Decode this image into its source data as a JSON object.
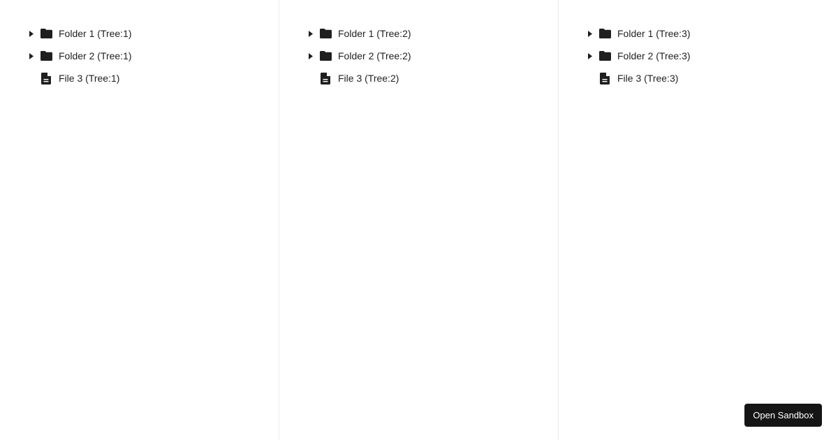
{
  "trees": [
    {
      "items": [
        {
          "label": "Folder 1 (Tree:1)",
          "kind": "folder",
          "icon": "folder-icon",
          "expanded": false
        },
        {
          "label": "Folder 2 (Tree:1)",
          "kind": "folder",
          "icon": "folder-icon",
          "expanded": false
        },
        {
          "label": "File 3 (Tree:1)",
          "kind": "file",
          "icon": "file-icon"
        }
      ]
    },
    {
      "items": [
        {
          "label": "Folder 1 (Tree:2)",
          "kind": "folder",
          "icon": "folder-icon",
          "expanded": false
        },
        {
          "label": "Folder 2 (Tree:2)",
          "kind": "folder",
          "icon": "folder-icon",
          "expanded": false
        },
        {
          "label": "File 3 (Tree:2)",
          "kind": "file",
          "icon": "file-icon"
        }
      ]
    },
    {
      "items": [
        {
          "label": "Folder 1 (Tree:3)",
          "kind": "folder",
          "icon": "folder-icon",
          "expanded": false
        },
        {
          "label": "Folder 2 (Tree:3)",
          "kind": "folder",
          "icon": "folder-icon",
          "expanded": false
        },
        {
          "label": "File 3 (Tree:3)",
          "kind": "file",
          "icon": "file-icon"
        }
      ]
    }
  ],
  "sandbox_button": {
    "label": "Open Sandbox"
  },
  "colors": {
    "text": "#1f1f1f",
    "icon": "#1f1f1f",
    "divider": "#ececec",
    "button_bg": "#151515",
    "button_text": "#ffffff"
  }
}
